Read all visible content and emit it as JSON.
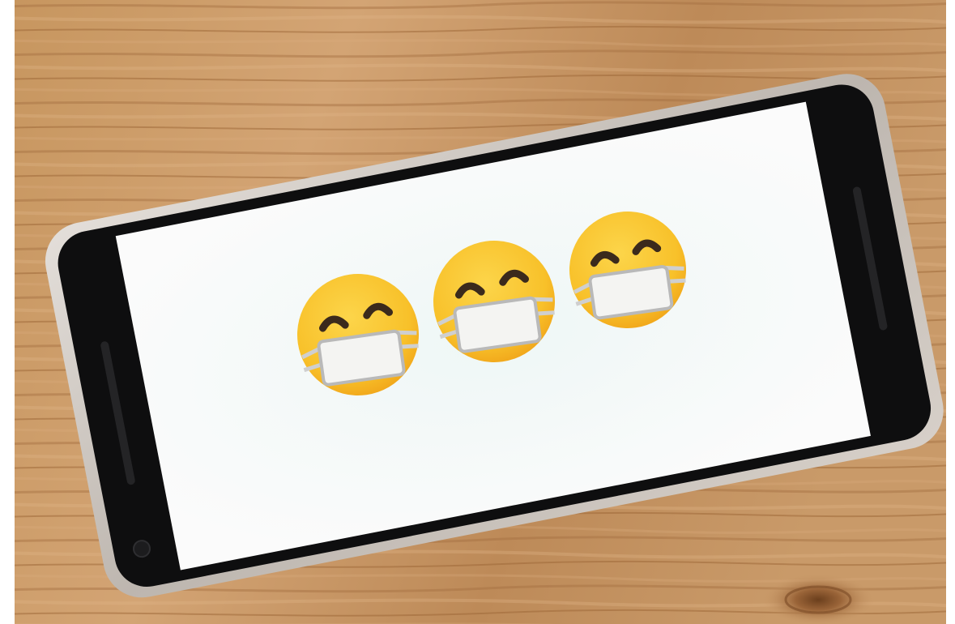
{
  "scene": {
    "subject": "smartphone-on-wooden-table",
    "emoji_count": 3,
    "emoji_icon": "face-with-medical-mask-icon"
  },
  "colors": {
    "page_background": "#ffffff",
    "wood_light": "#c9986a",
    "wood_mid": "#b5804f",
    "wood_dark": "#8f5d34",
    "phone_frame": "#cfc9c3",
    "phone_bezel": "#0e0e0f",
    "screen": "#fbfbfb",
    "emoji_yellow": "#f9c22a",
    "emoji_orange": "#f2a316",
    "mask_white": "#f4f4f2",
    "mask_outline": "#b9b9b9",
    "eye_dark": "#3b2a1c"
  }
}
